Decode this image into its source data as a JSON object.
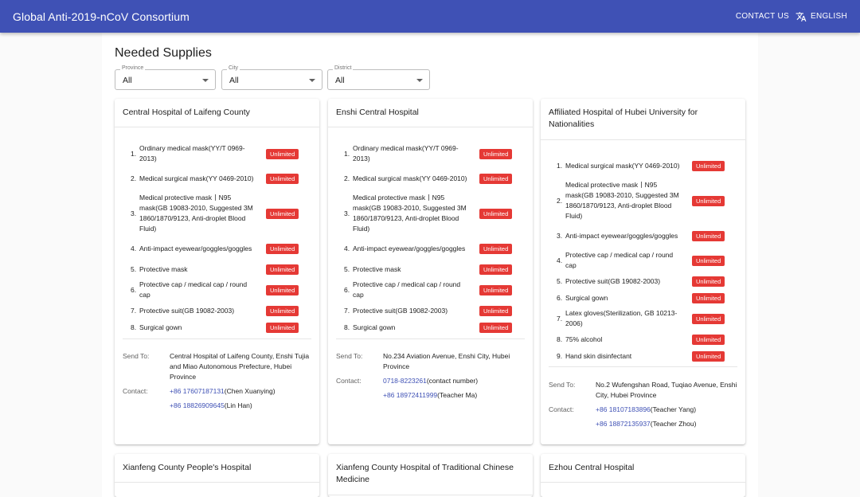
{
  "header": {
    "title": "Global Anti-2019-nCoV Consortium",
    "contact_label": "CONTACT US",
    "language_label": "ENGLISH"
  },
  "page": {
    "title": "Needed Supplies"
  },
  "filters": [
    {
      "label": "Province",
      "value": "All"
    },
    {
      "label": "City",
      "value": "All"
    },
    {
      "label": "District",
      "value": "All"
    }
  ],
  "labels": {
    "send_to": "Send To:",
    "contact": "Contact:"
  },
  "hospitals": [
    {
      "name": "Central Hospital of Laifeng County",
      "items": [
        {
          "num": "1.",
          "name": "Ordinary medical mask(YY/T 0969-2013)",
          "qty": "Unlimited"
        },
        {
          "num": "2.",
          "name": "Medical surgical mask(YY 0469-2010)",
          "qty": "Unlimited"
        },
        {
          "num": "3.",
          "name": "Medical protective mask丨N95 mask(GB 19083-2010, Suggested 3M 1860/1870/9123, Anti-droplet Blood Fluid)",
          "qty": "Unlimited"
        },
        {
          "num": "4.",
          "name": "Anti-impact eyewear/goggles/goggles",
          "qty": "Unlimited"
        },
        {
          "num": "5.",
          "name": "Protective mask",
          "qty": "Unlimited"
        },
        {
          "num": "6.",
          "name": "Protective cap / medical cap / round cap",
          "qty": "Unlimited"
        },
        {
          "num": "7.",
          "name": "Protective suit(GB 19082-2003)",
          "qty": "Unlimited"
        },
        {
          "num": "8.",
          "name": "Surgical gown",
          "qty": "Unlimited"
        }
      ],
      "send_to": "Central Hospital of Laifeng County, Enshi Tujia and Miao Autonomous Prefecture, Hubei Province",
      "contacts": [
        {
          "phone": "+86 17607187131",
          "person": "(Chen Xuanying)"
        },
        {
          "phone": "+86 18826909645",
          "person": "(Lin Han)"
        }
      ]
    },
    {
      "name": "Enshi Central Hospital",
      "items": [
        {
          "num": "1.",
          "name": "Ordinary medical mask(YY/T 0969-2013)",
          "qty": "Unlimited"
        },
        {
          "num": "2.",
          "name": "Medical surgical mask(YY 0469-2010)",
          "qty": "Unlimited"
        },
        {
          "num": "3.",
          "name": "Medical protective mask丨N95 mask(GB 19083-2010, Suggested 3M 1860/1870/9123, Anti-droplet Blood Fluid)",
          "qty": "Unlimited"
        },
        {
          "num": "4.",
          "name": "Anti-impact eyewear/goggles/goggles",
          "qty": "Unlimited"
        },
        {
          "num": "5.",
          "name": "Protective mask",
          "qty": "Unlimited"
        },
        {
          "num": "6.",
          "name": "Protective cap / medical cap / round cap",
          "qty": "Unlimited"
        },
        {
          "num": "7.",
          "name": "Protective suit(GB 19082-2003)",
          "qty": "Unlimited"
        },
        {
          "num": "8.",
          "name": "Surgical gown",
          "qty": "Unlimited"
        }
      ],
      "send_to": "No.234 Aviation Avenue, Enshi City, Hubei Province",
      "contacts": [
        {
          "phone": "0718-8223261",
          "person": "(contact number)"
        },
        {
          "phone": "+86 18972411999",
          "person": "(Teacher Ma)"
        }
      ]
    },
    {
      "name": "Affiliated Hospital of Hubei University for Nationalities",
      "items": [
        {
          "num": "1.",
          "name": "Medical surgical mask(YY 0469-2010)",
          "qty": "Unlimited"
        },
        {
          "num": "2.",
          "name": "Medical protective mask丨N95 mask(GB 19083-2010, Suggested 3M 1860/1870/9123, Anti-droplet Blood Fluid)",
          "qty": "Unlimited"
        },
        {
          "num": "3.",
          "name": "Anti-impact eyewear/goggles/goggles",
          "qty": "Unlimited"
        },
        {
          "num": "4.",
          "name": "Protective cap / medical cap / round cap",
          "qty": "Unlimited"
        },
        {
          "num": "5.",
          "name": "Protective suit(GB 19082-2003)",
          "qty": "Unlimited"
        },
        {
          "num": "6.",
          "name": "Surgical gown",
          "qty": "Unlimited"
        },
        {
          "num": "7.",
          "name": "Latex gloves(Sterilization, GB 10213-2006)",
          "qty": "Unlimited"
        },
        {
          "num": "8.",
          "name": "75% alcohol",
          "qty": "Unlimited"
        },
        {
          "num": "9.",
          "name": "Hand skin disinfectant",
          "qty": "Unlimited"
        }
      ],
      "send_to": "No.2 Wufengshan Road, Tuqiao Avenue, Enshi City, Hubei Province",
      "contacts": [
        {
          "phone": "+86 18107183896",
          "person": "(Teacher Yang)"
        },
        {
          "phone": "+86 18872135937",
          "person": "(Teacher Zhou)"
        }
      ]
    },
    {
      "name": "Xianfeng County People's Hospital"
    },
    {
      "name": "Xianfeng County Hospital of Traditional Chinese Medicine"
    },
    {
      "name": "Ezhou Central Hospital"
    }
  ]
}
